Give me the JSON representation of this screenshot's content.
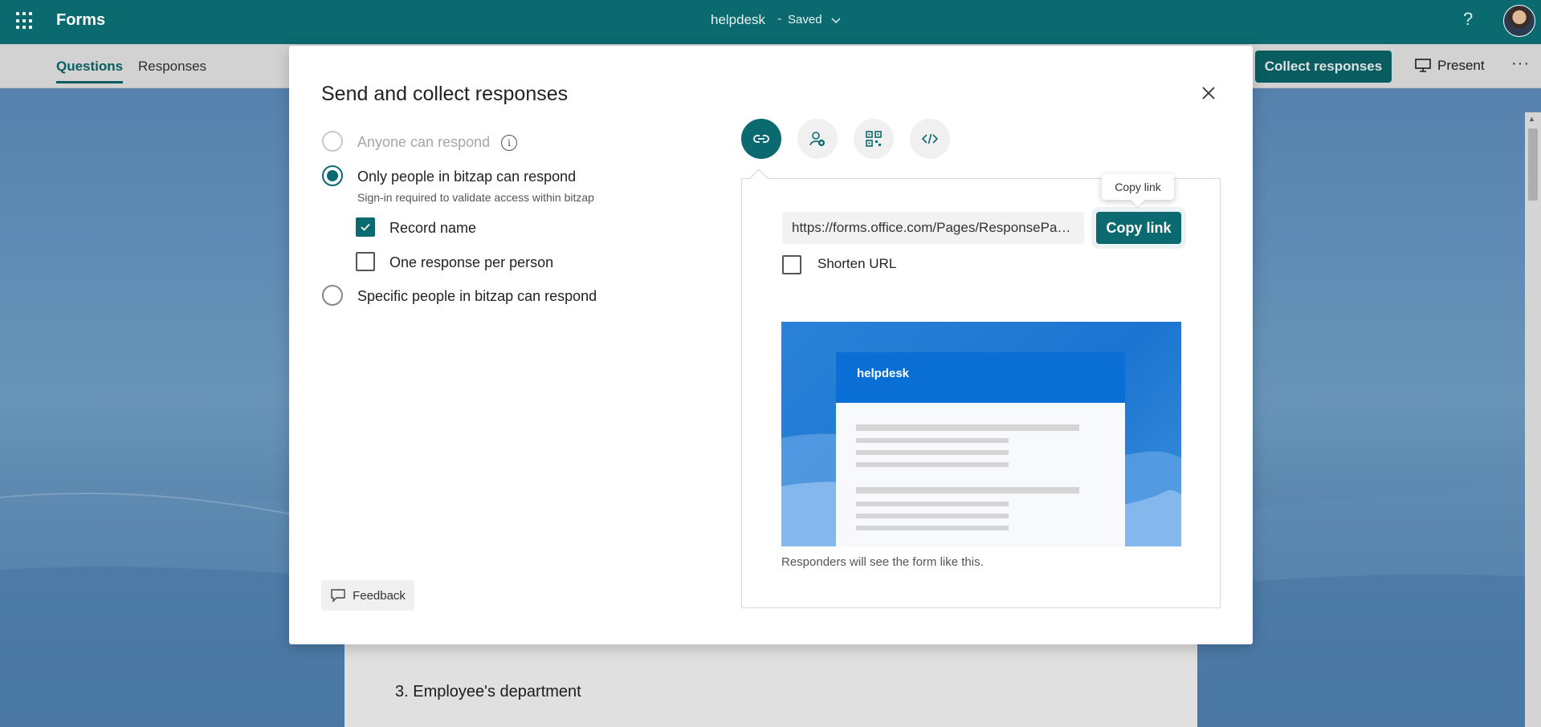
{
  "topbar": {
    "app_name": "Forms",
    "doc_title": "helpdesk",
    "separator": "-",
    "status": "Saved",
    "help": "?"
  },
  "subbar": {
    "tabs": [
      {
        "label": "Questions",
        "active": true
      },
      {
        "label": "Responses",
        "active": false
      }
    ],
    "collect_button": "Collect responses",
    "present_button": "Present",
    "more": "···"
  },
  "background_form": {
    "question": "3. Employee's department"
  },
  "dialog": {
    "title": "Send and collect responses",
    "options": [
      {
        "label": "Anyone can respond",
        "selected": false,
        "disabled": true
      },
      {
        "label": "Only people in bitzap can respond",
        "selected": true,
        "disabled": false,
        "sub": "Sign-in required to validate access within bitzap"
      },
      {
        "label": "Specific people in bitzap can respond",
        "selected": false,
        "disabled": false
      }
    ],
    "checkboxes": [
      {
        "label": "Record name",
        "checked": true
      },
      {
        "label": "One response per person",
        "checked": false
      }
    ],
    "feedback": "Feedback",
    "share_icons": [
      "link-icon",
      "person-add-icon",
      "qr-code-icon",
      "embed-code-icon"
    ],
    "link_panel": {
      "url": "https://forms.office.com/Pages/ResponsePag...",
      "copy_button": "Copy link",
      "tooltip": "Copy link",
      "shorten_label": "Shorten URL",
      "shorten_checked": false,
      "preview_title": "helpdesk",
      "preview_caption": "Responders will see the form like this."
    }
  },
  "colors": {
    "accent": "#0b6a6f",
    "preview_blue": "#1b74d0"
  }
}
